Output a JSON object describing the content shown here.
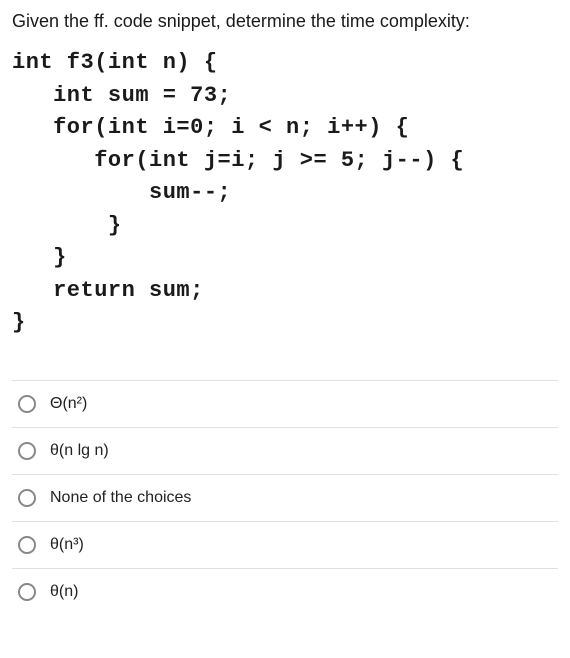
{
  "question": "Given the ff. code snippet, determine the time complexity:",
  "code": "int f3(int n) {\n   int sum = 73;\n   for(int i=0; i < n; i++) {\n      for(int j=i; j >= 5; j--) {\n          sum--;\n       }\n   }\n   return sum;\n}",
  "options": {
    "a": "Θ(n²)",
    "b": "θ(n lg n)",
    "c": "None of the choices",
    "d": "θ(n³)",
    "e": "θ(n)"
  }
}
